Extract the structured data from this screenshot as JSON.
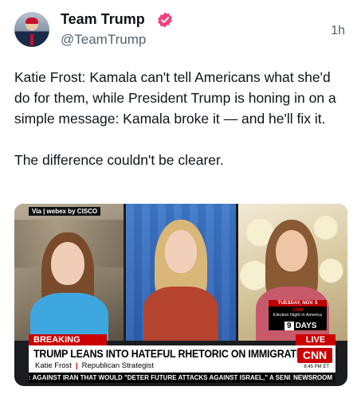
{
  "post": {
    "author_name": "Team Trump",
    "handle": "@TeamTrump",
    "timestamp": "1h",
    "paragraph1": "Katie Frost: Kamala can't tell Americans what she'd do for them, while President Trump is honing in on a simple message: Kamala broke it — and he'll fix it.",
    "paragraph2": "The difference couldn't be clearer."
  },
  "video": {
    "via_label": "Via | webex by CISCO",
    "breaking_label": "BREAKING NEWS",
    "live_label": "LIVE",
    "headline": "TRUMP LEANS INTO HATEFUL RHETORIC ON IMMIGRATION",
    "guest_name": "Katie Frost",
    "guest_title": "Republican Strategist",
    "network_logo": "CNN",
    "time": "8:45 PM ET",
    "ticker": ": AGAINST IRAN THAT WOULD \"DETER FUTURE ATTACKS AGAINST ISRAEL,\" A SENIOR U",
    "ticker_tag": "NEWSROOM",
    "countdown_date": "TUESDAY, NOV. 5",
    "countdown_network": "CNN",
    "countdown_show": "Election Night in America",
    "countdown_number": "9",
    "countdown_unit": "DAYS"
  },
  "colors": {
    "verified": "#f0427a",
    "cnn_red": "#cc0000",
    "text": "#0f1419",
    "muted": "#536471"
  }
}
